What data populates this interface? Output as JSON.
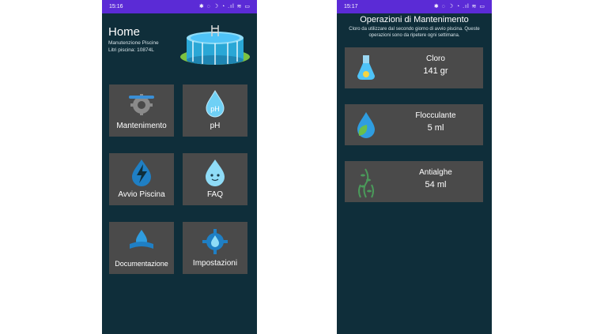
{
  "left": {
    "status": {
      "time": "15:16",
      "icons": "✱ ◌ ☽ ◔ .ıl ≋ ▭"
    },
    "home": {
      "title": "Home",
      "subtitle": "Manutenzione Piscine",
      "pool_liters": "Litri piscina: 10874L"
    },
    "tiles": [
      {
        "label": "Mantenimento",
        "icon": "gear-wrench-icon"
      },
      {
        "label": "pH",
        "icon": "ph-drop-icon"
      },
      {
        "label": "Avvio Piscina",
        "icon": "lightning-drop-icon"
      },
      {
        "label": "FAQ",
        "icon": "smiling-drop-icon"
      },
      {
        "label": "Documentazione",
        "icon": "book-drop-icon"
      },
      {
        "label": "Impostazioni",
        "icon": "settings-gear-drop-icon"
      }
    ]
  },
  "right": {
    "status": {
      "time": "15:17",
      "icons": "✱ ◌ ☽ ◔ .ıl ≋ ▭"
    },
    "title": "Operazioni di Mantenimento",
    "description": "Cloro da utilizzare dal secondo giorno di avvio piscina. Queste operazioni sono da ripetere ogni settimana.",
    "operations": [
      {
        "name": "Cloro",
        "quantity": "141 gr",
        "icon": "flask-icon"
      },
      {
        "name": "Flocculante",
        "quantity": "5 ml",
        "icon": "drop-leaf-icon"
      },
      {
        "name": "Antialghe",
        "quantity": "54 ml",
        "icon": "algae-icon"
      }
    ]
  },
  "colors": {
    "status_bar": "#5b2bd6",
    "background": "#0f2e3a",
    "tile": "#4a4a4a",
    "accent": "#4fc3f7"
  }
}
